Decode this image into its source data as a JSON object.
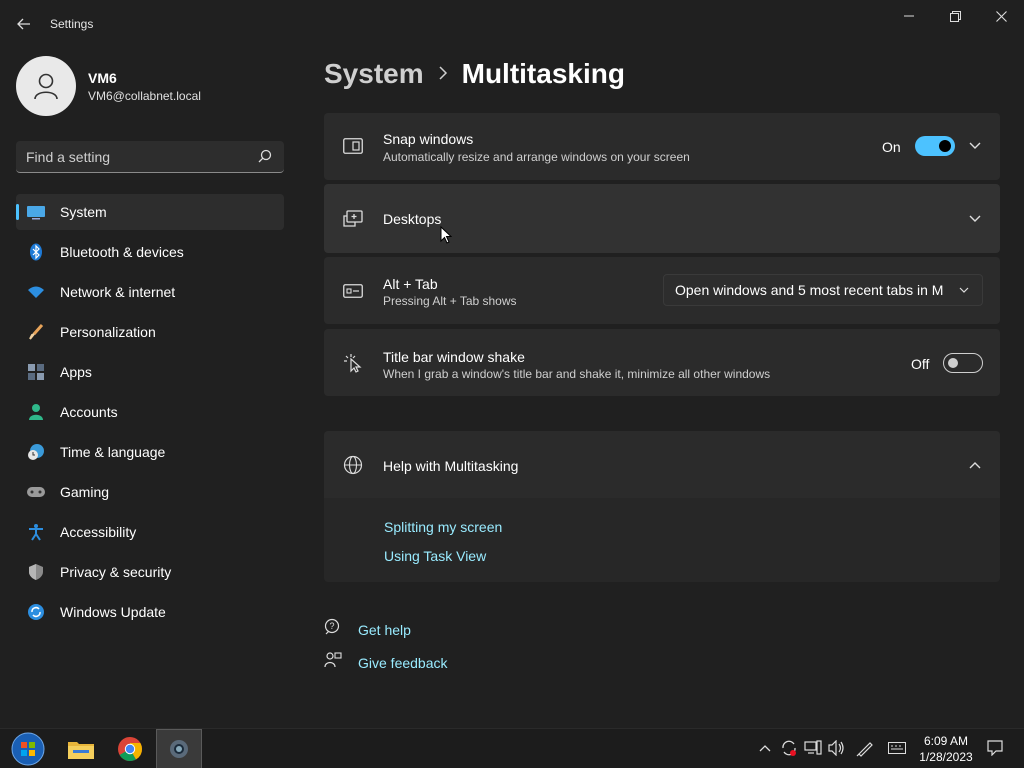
{
  "window": {
    "title": "Settings"
  },
  "user": {
    "name": "VM6",
    "email": "VM6@collabnet.local"
  },
  "search": {
    "placeholder": "Find a setting"
  },
  "nav": [
    {
      "label": "System",
      "icon": "system-icon",
      "active": true
    },
    {
      "label": "Bluetooth & devices",
      "icon": "bluetooth-icon"
    },
    {
      "label": "Network & internet",
      "icon": "wifi-icon"
    },
    {
      "label": "Personalization",
      "icon": "brush-icon"
    },
    {
      "label": "Apps",
      "icon": "apps-icon"
    },
    {
      "label": "Accounts",
      "icon": "person-icon"
    },
    {
      "label": "Time & language",
      "icon": "clock-globe-icon"
    },
    {
      "label": "Gaming",
      "icon": "gamepad-icon"
    },
    {
      "label": "Accessibility",
      "icon": "accessibility-icon"
    },
    {
      "label": "Privacy & security",
      "icon": "shield-icon"
    },
    {
      "label": "Windows Update",
      "icon": "update-icon"
    }
  ],
  "breadcrumb": {
    "parent": "System",
    "current": "Multitasking"
  },
  "settings": {
    "snap": {
      "title": "Snap windows",
      "desc": "Automatically resize and arrange windows on your screen",
      "state": "On"
    },
    "desktops": {
      "title": "Desktops"
    },
    "alttab": {
      "title": "Alt + Tab",
      "desc": "Pressing Alt + Tab shows",
      "value": "Open windows and 5 most recent tabs in M"
    },
    "shake": {
      "title": "Title bar window shake",
      "desc": "When I grab a window's title bar and shake it, minimize all other windows",
      "state": "Off"
    }
  },
  "help": {
    "title": "Help with Multitasking",
    "links": [
      "Splitting my screen",
      "Using Task View"
    ]
  },
  "footer": {
    "get_help": "Get help",
    "give_feedback": "Give feedback"
  },
  "taskbar": {
    "time": "6:09 AM",
    "date": "1/28/2023"
  },
  "colors": {
    "accent": "#4cc2ff",
    "link": "#99ebff",
    "bg": "#202020",
    "card": "#2b2b2b"
  }
}
